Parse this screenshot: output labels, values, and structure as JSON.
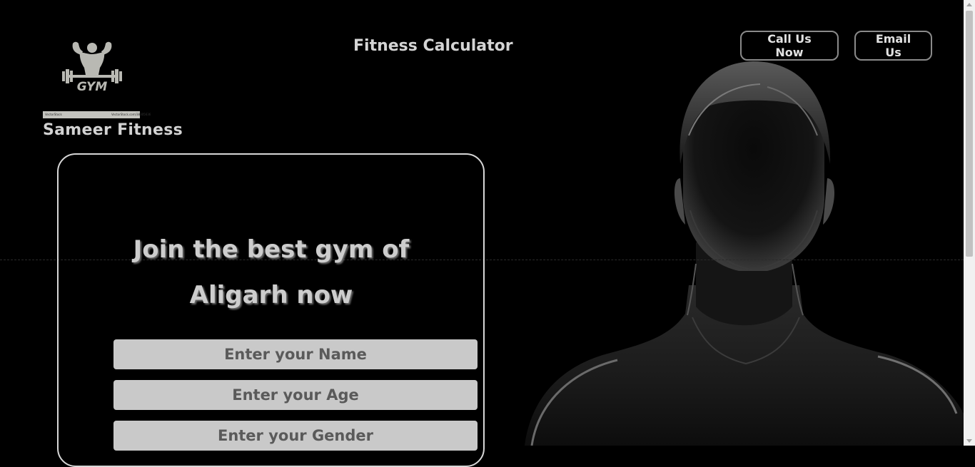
{
  "logo": {
    "icon": "gym-bodybuilder-logo",
    "text": "GYM",
    "strip_left": "VectorStock",
    "strip_right": "VectorStock.com/38305636"
  },
  "brand": {
    "name": "Sameer Fitness"
  },
  "header": {
    "title": "Fitness Calculator"
  },
  "nav": {
    "call_label": "Call Us Now",
    "email_label": "Email Us"
  },
  "hero": {
    "headline_line1": "Join the best gym of",
    "headline_line2": "Aligarh now"
  },
  "form": {
    "name_placeholder": "Enter your Name",
    "age_placeholder": "Enter your Age",
    "gender_placeholder": "Enter your Gender"
  },
  "colors": {
    "background": "#000000",
    "text": "#cfcfcf",
    "field": "#c9c9c9",
    "border": "#d7d7d7"
  }
}
